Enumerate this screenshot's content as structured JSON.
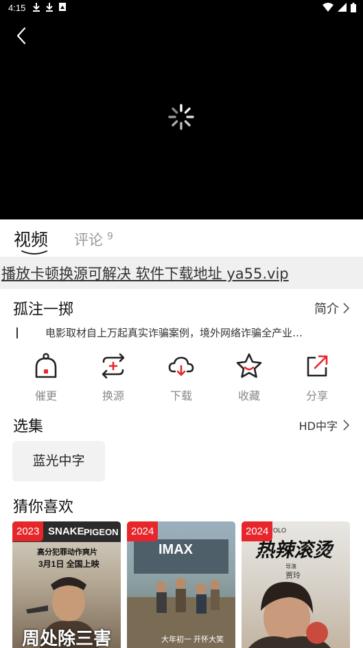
{
  "status_bar": {
    "time": "4:15",
    "left_icons": [
      "download-icon",
      "download-icon",
      "image-notification-icon"
    ],
    "right_icons": [
      "wifi-icon",
      "signal-icon",
      "battery-icon"
    ]
  },
  "player": {
    "back_icon": "back-arrow-icon",
    "loading_icon": "loading-spinner-icon"
  },
  "tabs": {
    "video": "视频",
    "comment": "评论",
    "comment_count": "9"
  },
  "notice": "播放卡顿换源可解决 软件下载地址 ya55.vip",
  "detail": {
    "title": "孤注一掷",
    "intro_label": "简介",
    "description": "电影取材自上万起真实诈骗案例，境外网络诈骗全产业…"
  },
  "actions": [
    {
      "label": "催更",
      "icon": "bell-icon"
    },
    {
      "label": "换源",
      "icon": "switch-source-icon"
    },
    {
      "label": "下载",
      "icon": "cloud-download-icon"
    },
    {
      "label": "收藏",
      "icon": "star-icon"
    },
    {
      "label": "分享",
      "icon": "share-icon"
    }
  ],
  "episodes": {
    "heading": "选集",
    "quality": "HD中字",
    "items": [
      "蓝光中字"
    ]
  },
  "recommend": {
    "heading": "猜你喜欢",
    "items": [
      {
        "year": "2023",
        "poster_lines": [
          "SNAKE",
          "PIGEON",
          "高分犯罪动作爽片",
          "3月1日 全国上映",
          "周处除三害"
        ]
      },
      {
        "year": "2024",
        "poster_lines": [
          "IMAX",
          "大年初一 开怀大笑"
        ]
      },
      {
        "year": "2024",
        "poster_lines": [
          "YOLO",
          "热辣滚烫",
          "导演",
          "贾玲"
        ]
      }
    ]
  },
  "colors": {
    "accent_red": "#e6262b",
    "player_bg": "#000000",
    "notice_bg": "#f0f0f0"
  }
}
